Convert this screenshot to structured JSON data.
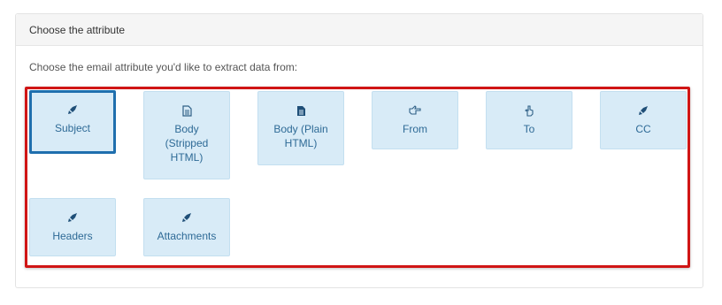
{
  "panel": {
    "heading": "Choose the attribute",
    "prompt": "Choose the email attribute you'd like to extract data from:"
  },
  "colors": {
    "accent": "#1f6fae",
    "tile_bg": "#d8ebf7",
    "highlight": "#d01515"
  },
  "options": [
    {
      "label": "Subject",
      "icon": "rocket-icon",
      "selected": true
    },
    {
      "label": "Body (Stripped HTML)",
      "icon": "file-text-outline-icon",
      "selected": false
    },
    {
      "label": "Body (Plain HTML)",
      "icon": "file-text-icon",
      "selected": false
    },
    {
      "label": "From",
      "icon": "hand-point-right-icon",
      "selected": false
    },
    {
      "label": "To",
      "icon": "hand-point-up-icon",
      "selected": false
    },
    {
      "label": "CC",
      "icon": "rocket-icon",
      "selected": false
    },
    {
      "label": "Headers",
      "icon": "rocket-icon",
      "selected": false
    },
    {
      "label": "Attachments",
      "icon": "rocket-icon",
      "selected": false
    }
  ]
}
